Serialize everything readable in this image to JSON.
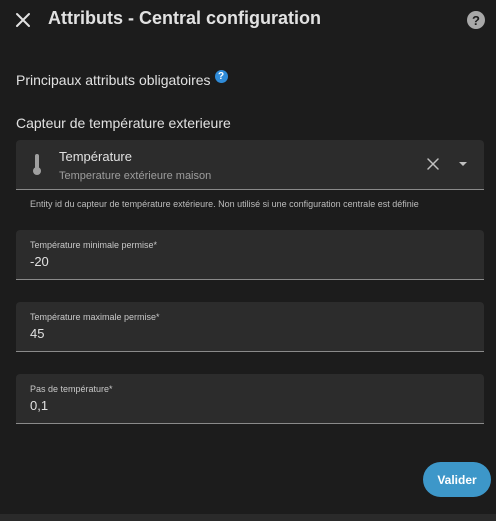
{
  "dialog": {
    "title": "Attributs - Central configuration",
    "help_glyph": "?",
    "close_icon": "close-icon",
    "help_icon": "help-circle-icon"
  },
  "section": {
    "title": "Principaux attributs obligatoires",
    "info_glyph": "?"
  },
  "sensor": {
    "label": "Capteur de température exterieure",
    "entity_name": "Température",
    "entity_secondary": "Temperature extérieure maison",
    "icon": "thermometer-icon",
    "helper": "Entity id du capteur de température extérieure. Non utilisé si une configuration centrale est définie"
  },
  "fields": {
    "min_temp": {
      "label": "Température minimale permise*",
      "value": "-20"
    },
    "max_temp": {
      "label": "Température maximale permise*",
      "value": "45"
    },
    "step": {
      "label": "Pas de température*",
      "value": "0,1"
    }
  },
  "actions": {
    "submit_label": "Valider"
  },
  "colors": {
    "background": "#1c1c1c",
    "field_background": "#2c2c2c",
    "accent": "#3d97c9",
    "info": "#2f8bd8"
  }
}
